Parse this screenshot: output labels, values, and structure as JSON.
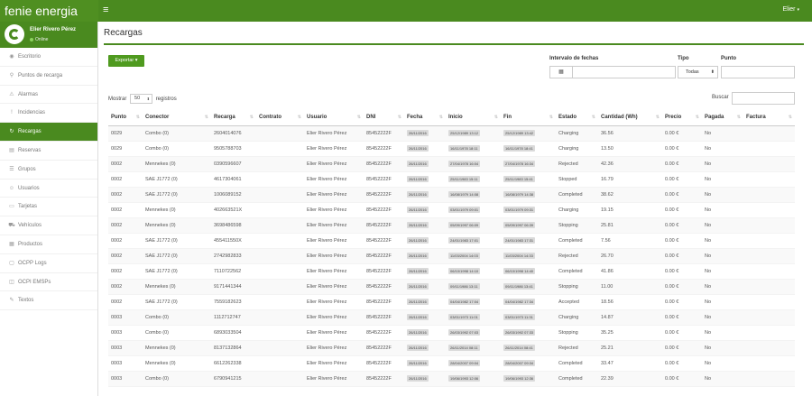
{
  "app": {
    "brand": "fenie energia",
    "menu_toggle": "≡",
    "user_name": "Elier",
    "user_caret": "▾"
  },
  "profile": {
    "name": "Elier Rivero Pérez",
    "status": "Online"
  },
  "sidebar": {
    "items": [
      {
        "icon": "◉",
        "label": "Escritorio"
      },
      {
        "icon": "⚲",
        "label": "Puntos de recarga"
      },
      {
        "icon": "⚠",
        "label": "Alarmas"
      },
      {
        "icon": "!",
        "label": "Incidencias"
      },
      {
        "icon": "↻",
        "label": "Recargas",
        "active": true
      },
      {
        "icon": "▤",
        "label": "Reservas"
      },
      {
        "icon": "☰",
        "label": "Grupos"
      },
      {
        "icon": "☺",
        "label": "Usuarios"
      },
      {
        "icon": "▭",
        "label": "Tarjetas"
      },
      {
        "icon": "⛟",
        "label": "Vehículos"
      },
      {
        "icon": "▦",
        "label": "Productos"
      },
      {
        "icon": "▢",
        "label": "OCPP Logs"
      },
      {
        "icon": "◫",
        "label": "OCPI EMSPs"
      },
      {
        "icon": "✎",
        "label": "Textos"
      }
    ]
  },
  "main": {
    "title": "Recargas",
    "export_label": "Exportar ▾",
    "date_range_label": "Intervalo de fechas",
    "date_icon": "▦",
    "tipo_label": "Tipo",
    "tipo_value": "Todas",
    "tipo_caret": "⬍",
    "punto_label": "Punto",
    "mostrar_pre": "Mostrar",
    "mostrar_value": "50",
    "mostrar_caret": "⬍",
    "mostrar_post": "registros",
    "buscar_label": "Buscar"
  },
  "table": {
    "sort_icon": "⇅",
    "columns": [
      "Punto",
      "Conector",
      "Recarga",
      "Contrato",
      "Usuario",
      "DNI",
      "Fecha",
      "Inicio",
      "Fin",
      "Estado",
      "Cantidad (Wh)",
      "Precio",
      "Pagada",
      "Factura"
    ],
    "rows": [
      [
        "0029",
        "Combo (0)",
        "2604014076",
        "",
        "Elier Rivero Pérez",
        "85452222F",
        "26/11/2016",
        "25/12/1989 13:12",
        "25/12/1989 13:42",
        "Charging",
        "36.56",
        "0.00 €",
        "No",
        ""
      ],
      [
        "0029",
        "Combo (0)",
        "9505788703",
        "",
        "Elier Rivero Pérez",
        "85452222F",
        "26/11/2016",
        "16/11/1978 18:11",
        "16/11/1978 18:41",
        "Charging",
        "13.50",
        "0.00 €",
        "No",
        ""
      ],
      [
        "0002",
        "Mennekes (0)",
        "0390596607",
        "",
        "Elier Rivero Pérez",
        "85452222F",
        "26/11/2016",
        "27/04/1978 16:04",
        "27/04/1978 16:34",
        "Rejected",
        "42.36",
        "0.00 €",
        "No",
        ""
      ],
      [
        "0002",
        "SAE J1772 (0)",
        "4617304061",
        "",
        "Elier Rivero Pérez",
        "85452222F",
        "26/11/2016",
        "25/11/1983 15:11",
        "25/11/1983 15:41",
        "Stopped",
        "16.79",
        "0.00 €",
        "No",
        ""
      ],
      [
        "0002",
        "SAE J1772 (0)",
        "1006089152",
        "",
        "Elier Rivero Pérez",
        "85452222F",
        "26/11/2016",
        "16/08/1979 14:08",
        "16/08/1979 14:38",
        "Completed",
        "38.62",
        "0.00 €",
        "No",
        ""
      ],
      [
        "0002",
        "Mennekes (0)",
        "402663521X",
        "",
        "Elier Rivero Pérez",
        "85452222F",
        "26/11/2016",
        "03/01/1979 09:01",
        "03/01/1979 09:31",
        "Charging",
        "19.15",
        "0.00 €",
        "No",
        ""
      ],
      [
        "0002",
        "Mennekes (0)",
        "3698486598",
        "",
        "Elier Rivero Pérez",
        "85452222F",
        "26/11/2016",
        "05/09/1997 06:09",
        "05/09/1997 06:39",
        "Stopping",
        "25.81",
        "0.00 €",
        "No",
        ""
      ],
      [
        "0002",
        "SAE J1772 (0)",
        "455411550X",
        "",
        "Elier Rivero Pérez",
        "85452222F",
        "26/11/2016",
        "24/01/1983 17:01",
        "24/01/1983 17:31",
        "Completed",
        "7.56",
        "0.00 €",
        "No",
        ""
      ],
      [
        "0002",
        "SAE J1772 (0)",
        "2742982833",
        "",
        "Elier Rivero Pérez",
        "85452222F",
        "26/11/2016",
        "11/03/2004 14:03",
        "11/03/2004 14:33",
        "Rejected",
        "26.70",
        "0.00 €",
        "No",
        ""
      ],
      [
        "0002",
        "SAE J1772 (0)",
        "7110722562",
        "",
        "Elier Rivero Pérez",
        "85452222F",
        "26/11/2016",
        "06/10/1998 14:10",
        "06/10/1998 14:40",
        "Completed",
        "41.86",
        "0.00 €",
        "No",
        ""
      ],
      [
        "0002",
        "Mennekes (0)",
        "9171441344",
        "",
        "Elier Rivero Pérez",
        "85452222F",
        "26/11/2016",
        "09/11/1986 13:11",
        "09/11/1986 13:41",
        "Stopping",
        "11.00",
        "0.00 €",
        "No",
        ""
      ],
      [
        "0002",
        "SAE J1772 (0)",
        "7559182623",
        "",
        "Elier Rivero Pérez",
        "85452222F",
        "26/11/2016",
        "04/04/1982 17:04",
        "04/04/1982 17:34",
        "Accepted",
        "18.56",
        "0.00 €",
        "No",
        ""
      ],
      [
        "0003",
        "Combo (0)",
        "1112712747",
        "",
        "Elier Rivero Pérez",
        "85452222F",
        "26/11/2016",
        "03/01/1973 11:01",
        "03/01/1973 11:31",
        "Charging",
        "14.87",
        "0.00 €",
        "No",
        ""
      ],
      [
        "0003",
        "Combo (0)",
        "6893033504",
        "",
        "Elier Rivero Pérez",
        "85452222F",
        "26/11/2016",
        "26/03/1992 07:03",
        "26/03/1992 07:33",
        "Stopping",
        "35.25",
        "0.00 €",
        "No",
        ""
      ],
      [
        "0003",
        "Mennekes (0)",
        "8137132864",
        "",
        "Elier Rivero Pérez",
        "85452222F",
        "26/11/2016",
        "26/11/2014 08:11",
        "26/11/2014 08:41",
        "Rejected",
        "25.21",
        "0.00 €",
        "No",
        ""
      ],
      [
        "0003",
        "Mennekes (0)",
        "6612262338",
        "",
        "Elier Rivero Pérez",
        "85452222F",
        "26/11/2016",
        "28/04/2007 09:04",
        "28/04/2007 09:34",
        "Completed",
        "33.47",
        "0.00 €",
        "No",
        ""
      ],
      [
        "0003",
        "Combo (0)",
        "6790941215",
        "",
        "Elier Rivero Pérez",
        "85452222F",
        "26/11/2016",
        "19/06/1993 12:06",
        "19/06/1993 12:36",
        "Completed",
        "22.39",
        "0.00 €",
        "No",
        ""
      ]
    ]
  }
}
